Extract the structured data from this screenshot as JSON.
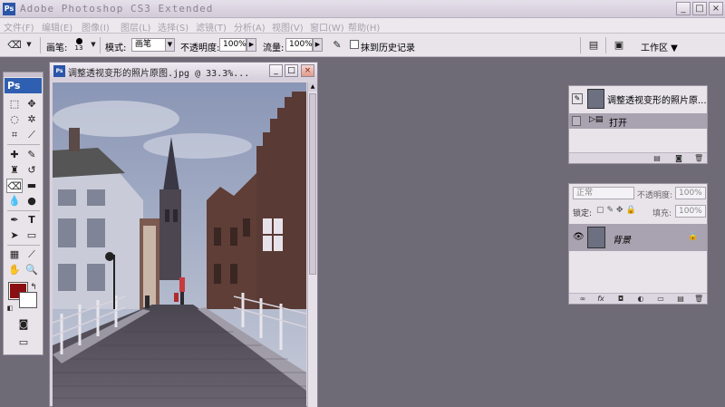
{
  "app": {
    "title": "Adobe Photoshop CS3 Extended",
    "logo": "Ps"
  },
  "window_controls": {
    "minimize": "_",
    "maximize": "□",
    "close": "×"
  },
  "menu": [
    "文件(F)",
    "编辑(E)",
    "图像(I)",
    "图层(L)",
    "选择(S)",
    "滤镜(T)",
    "分析(A)",
    "视图(V)",
    "窗口(W)",
    "帮助(H)"
  ],
  "options": {
    "brush_label": "画笔:",
    "brush_size": "13",
    "mode_label": "模式:",
    "mode_value": "画笔",
    "opacity_label": "不透明度:",
    "opacity_value": "100%",
    "flow_label": "流量:",
    "flow_value": "100%",
    "erase_history_label": "抹到历史记录",
    "workspace_label": "工作区 ▼"
  },
  "document": {
    "title": "调整透视变形的照片原图.jpg @ 33.3%..."
  },
  "history": {
    "snapshot_name": "调整透视变形的照片原...",
    "step_name": "打开"
  },
  "layers": {
    "blend_mode": "正常",
    "opacity_label": "不透明度:",
    "opacity_value": "100%",
    "lock_label": "锁定:",
    "fill_label": "填充:",
    "fill_value": "100%",
    "layer_name": "背景"
  },
  "colors": {
    "foreground": "#8b0e12",
    "background": "#ffffff",
    "workspace": "#6e6a76"
  }
}
